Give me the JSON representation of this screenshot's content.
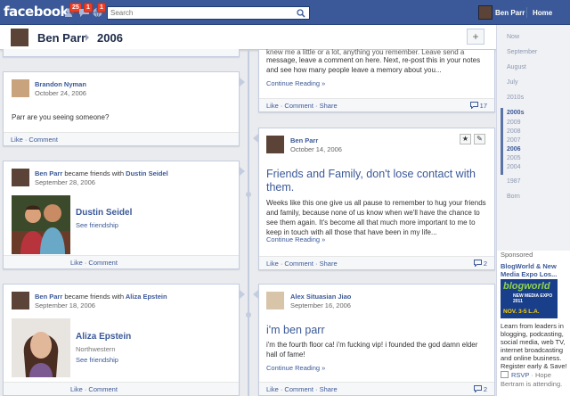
{
  "topbar": {
    "logo": "facebook",
    "notifications": {
      "friend_requests": "25",
      "messages": "1",
      "notifications": "1"
    },
    "search": {
      "placeholder": "Search"
    },
    "user_name": "Ben Parr",
    "home_label": "Home"
  },
  "header": {
    "name": "Ben Parr",
    "year": "2006",
    "add_label": "+"
  },
  "posts_left": [
    {
      "author": "Brandon Nyman",
      "date": "October 24, 2006",
      "text": "Parr are you seeing someone?",
      "actions": "Like · Comment"
    },
    {
      "author": "Ben Parr",
      "event": "became friends with",
      "friend": "Dustin Seidel",
      "date": "September 28, 2006",
      "friend_name": "Dustin Seidel",
      "link": "See friendship",
      "actions": "Like · Comment"
    },
    {
      "author": "Ben Parr",
      "event": "became friends with",
      "friend": "Aliza Epstein",
      "date": "September 18, 2006",
      "friend_name": "Aliza Epstein",
      "network": "Northwestern",
      "link": "See friendship",
      "actions": "Like · Comment"
    }
  ],
  "posts_right": [
    {
      "text_line1": "knew me a little or a lot, anything you remember. Leave send a",
      "text_line2": "message, leave a comment on here. Next, re-post this in your notes",
      "text_line3": "and see how many people leave a memory about you...",
      "continue": "Continue Reading »",
      "actions": "Like · Comment · Share",
      "comments": "17"
    },
    {
      "author": "Ben Parr",
      "date": "October 14, 2006",
      "title": "Friends and Family, don't lose contact with them.",
      "text": "Weeks like this one give us all pause to remember to hug your friends and family, because none of us know when we'll have the chance to see them again. It's become all that much more important to me to keep in touch with all those that have been in my life...",
      "continue": "Continue Reading »",
      "actions": "Like · Comment · Share",
      "comments": "2"
    },
    {
      "author": "Alex Situasian Jiao",
      "date": "September 16, 2006",
      "title": "i'm ben parr",
      "text": "i'm the fourth floor ca! i'm fucking vip! i founded the god damn elder hall of fame!",
      "continue": "Continue Reading »",
      "actions": "Like · Comment · Share",
      "comments": "2"
    }
  ],
  "timeline_nav": {
    "items": [
      "Now",
      "September",
      "August",
      "July",
      "2010s",
      "2000s",
      "2009",
      "2008",
      "2007",
      "2006",
      "2005",
      "2004",
      "1987",
      "Born"
    ]
  },
  "sponsored": {
    "header": "Sponsored",
    "title": "BlogWorld & New Media Expo Los...",
    "image_text1": "blogworld",
    "image_text2": "NEW MEDIA EXPO 2011",
    "image_text3": "NOV. 3-5 L.A.",
    "body": "Learn from leaders in blogging, podcasting, social media, web TV, internet broadcasting and online business. Register early & Save!",
    "rsvp": "RSVP",
    "rsvp_sep": " · Hope",
    "attending": "Bertram is attending."
  },
  "colors": {
    "brand": "#3b5998",
    "background": "#e9ebee",
    "badge": "#f03d25"
  }
}
